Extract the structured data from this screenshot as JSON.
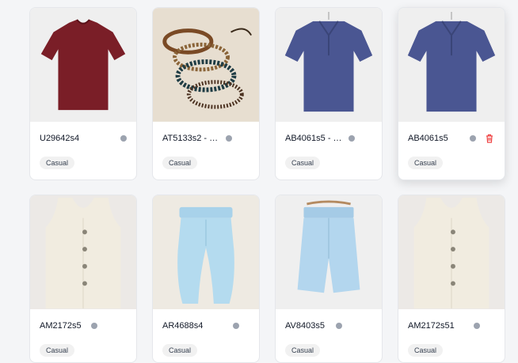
{
  "products": [
    {
      "code": "U29642s4",
      "tag": "Casual",
      "dot_color": "#9ca3af",
      "image": "maroon-tshirt"
    },
    {
      "code": "AT5133s2 - Co...",
      "tag": "Casual",
      "dot_color": "#9ca3af",
      "image": "bracelets"
    },
    {
      "code": "AB4061s5 - Co...",
      "tag": "Casual",
      "dot_color": "#9ca3af",
      "image": "navy-polo"
    },
    {
      "code": "AB4061s5",
      "tag": "Casual",
      "dot_color": "#9ca3af",
      "image": "navy-polo",
      "show_delete": true
    },
    {
      "code": "AM2172s5",
      "tag": "Casual",
      "dot_color": "#9ca3af",
      "image": "cream-vest"
    },
    {
      "code": "AR4688s4",
      "tag": "Casual",
      "dot_color": "#9ca3af",
      "image": "blue-pants"
    },
    {
      "code": "AV8403s5",
      "tag": "Casual",
      "dot_color": "#9ca3af",
      "image": "blue-shorts"
    },
    {
      "code": "AM2172s51",
      "tag": "Casual",
      "dot_color": "#9ca3af",
      "image": "cream-vest"
    }
  ],
  "colors": {
    "delete": "#ef4444"
  }
}
